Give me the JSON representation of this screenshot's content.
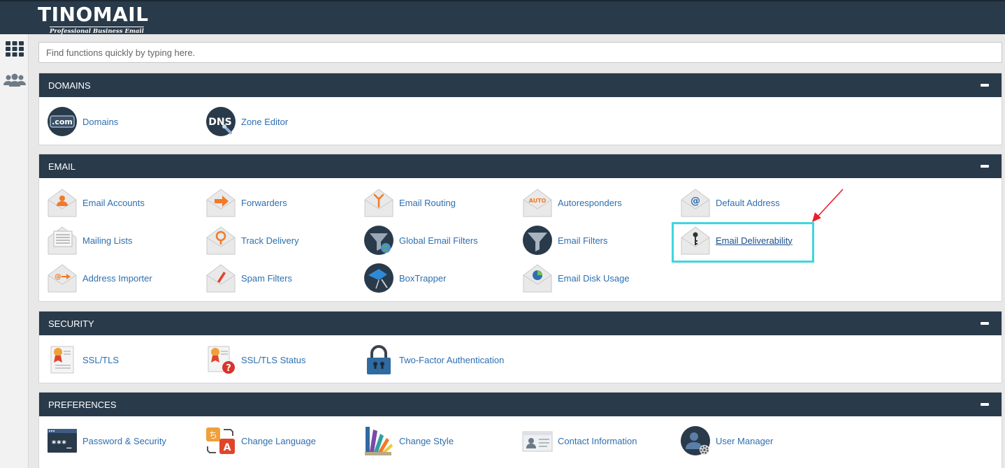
{
  "brand": {
    "name": "TINOMAIL",
    "tagline": "Professional Business Email"
  },
  "search": {
    "placeholder": "Find functions quickly by typing here."
  },
  "sections": {
    "domains": {
      "title": "DOMAINS",
      "items": [
        {
          "label": "Domains",
          "icon": "dotcom-icon"
        },
        {
          "label": "Zone Editor",
          "icon": "dns-icon"
        }
      ]
    },
    "email": {
      "title": "EMAIL",
      "items": [
        {
          "label": "Email Accounts",
          "icon": "email-accounts-icon"
        },
        {
          "label": "Forwarders",
          "icon": "forwarders-icon"
        },
        {
          "label": "Email Routing",
          "icon": "email-routing-icon"
        },
        {
          "label": "Autoresponders",
          "icon": "autoresponders-icon"
        },
        {
          "label": "Default Address",
          "icon": "default-address-icon"
        },
        {
          "label": "Mailing Lists",
          "icon": "mailing-lists-icon"
        },
        {
          "label": "Track Delivery",
          "icon": "track-delivery-icon"
        },
        {
          "label": "Global Email Filters",
          "icon": "global-filter-icon"
        },
        {
          "label": "Email Filters",
          "icon": "funnel-icon"
        },
        {
          "label": "Email Deliverability",
          "icon": "email-key-icon"
        },
        {
          "label": "Address Importer",
          "icon": "address-importer-icon"
        },
        {
          "label": "Spam Filters",
          "icon": "spam-filters-icon"
        },
        {
          "label": "BoxTrapper",
          "icon": "boxtrapper-icon"
        },
        {
          "label": "Email Disk Usage",
          "icon": "disk-usage-icon"
        }
      ]
    },
    "security": {
      "title": "SECURITY",
      "items": [
        {
          "label": "SSL/TLS",
          "icon": "certificate-icon"
        },
        {
          "label": "SSL/TLS Status",
          "icon": "certificate-status-icon"
        },
        {
          "label": "Two-Factor Authentication",
          "icon": "padlock-icon"
        }
      ]
    },
    "preferences": {
      "title": "PREFERENCES",
      "items": [
        {
          "label": "Password & Security",
          "icon": "password-icon"
        },
        {
          "label": "Change Language",
          "icon": "language-icon"
        },
        {
          "label": "Change Style",
          "icon": "palette-icon"
        },
        {
          "label": "Contact Information",
          "icon": "contact-card-icon"
        },
        {
          "label": "User Manager",
          "icon": "user-manager-icon"
        }
      ]
    }
  },
  "colors": {
    "header": "#293a4a",
    "link": "#2d6fb0",
    "highlight": "#3fd6dc",
    "arrow": "#e8202a",
    "accent_orange": "#f07a2a"
  }
}
